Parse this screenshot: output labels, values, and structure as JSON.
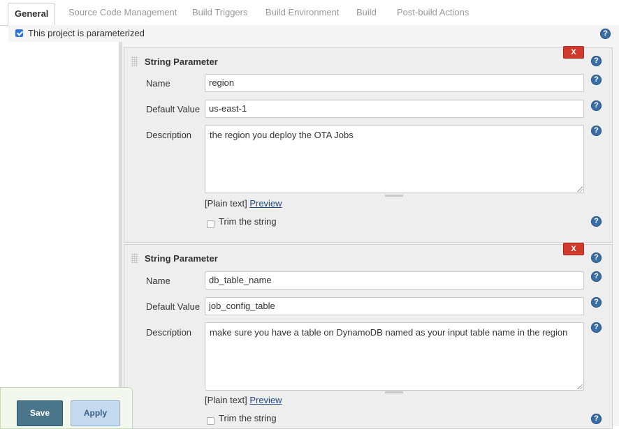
{
  "tabs": [
    {
      "label": "General",
      "active": true
    },
    {
      "label": "Source Code Management"
    },
    {
      "label": "Build Triggers"
    },
    {
      "label": "Build Environment"
    },
    {
      "label": "Build"
    },
    {
      "label": "Post-build Actions"
    }
  ],
  "parameterized": {
    "label": "This project is parameterized",
    "checked": true
  },
  "help_glyph": "?",
  "parameters": [
    {
      "title": "String Parameter",
      "delete_label": "X",
      "name_label": "Name",
      "name_value": "region",
      "default_label": "Default Value",
      "default_value": "us-east-1",
      "description_label": "Description",
      "description_value": "the region you deploy the OTA Jobs",
      "plain_text": "[Plain text]",
      "preview": "Preview",
      "trim_label": "Trim the string",
      "trim_checked": false
    },
    {
      "title": "String Parameter",
      "delete_label": "X",
      "name_label": "Name",
      "name_value": "db_table_name",
      "default_label": "Default Value",
      "default_value": "job_config_table",
      "description_label": "Description",
      "description_value": "make sure you have a table on DynamoDB named as your input table name in the region",
      "plain_text": "[Plain text]",
      "preview": "Preview",
      "trim_label": "Trim the string",
      "trim_checked": false
    }
  ],
  "buttons": {
    "save": "Save",
    "apply": "Apply"
  },
  "colors": {
    "accent": "#2f73d9",
    "delete": "#d0392b",
    "save": "#4b758b",
    "apply": "#c5daef",
    "help": "#3b6ea5"
  }
}
